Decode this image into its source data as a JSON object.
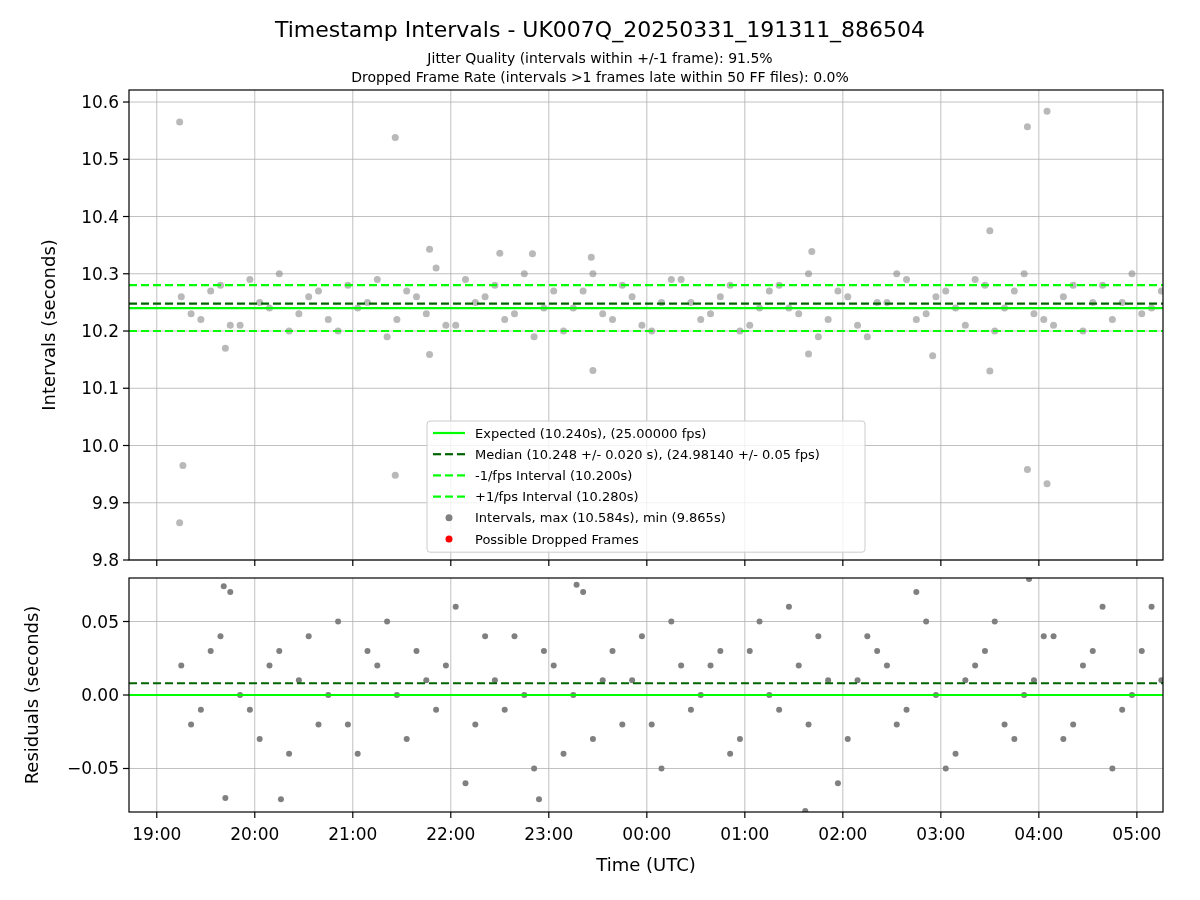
{
  "figure": {
    "title": "Timestamp Intervals - UK007Q_20250331_191311_886504",
    "subtitles": [
      "Jitter Quality (intervals within +/-1 frame): 91.5%",
      "Dropped Frame Rate (intervals >1 frames late within 50 FF files): 0.0%"
    ]
  },
  "panels": [
    {
      "chart_data": {
        "type": "scatter",
        "ylabel": "Intervals (seconds)",
        "grid": true,
        "xlim": [
          "2025-03-31T18:43",
          "2025-04-01T05:16"
        ],
        "ylim": [
          9.8,
          10.621
        ],
        "yticks": [
          {
            "value": 9.8,
            "label": "9.8"
          },
          {
            "value": 9.9,
            "label": "9.9"
          },
          {
            "value": 10.0,
            "label": "10.0"
          },
          {
            "value": 10.1,
            "label": "10.1"
          },
          {
            "value": 10.2,
            "label": "10.2"
          },
          {
            "value": 10.3,
            "label": "10.3"
          },
          {
            "value": 10.4,
            "label": "10.4"
          },
          {
            "value": 10.5,
            "label": "10.5"
          },
          {
            "value": 10.6,
            "label": "10.6"
          }
        ],
        "x": [
          "2025-03-31T19:15",
          "2025-03-31T19:27",
          "2025-03-31T19:39",
          "2025-03-31T19:51",
          "2025-03-31T20:03",
          "2025-03-31T20:15",
          "2025-03-31T20:27",
          "2025-03-31T20:39",
          "2025-03-31T20:51",
          "2025-03-31T21:03",
          "2025-03-31T21:15",
          "2025-03-31T21:27",
          "2025-03-31T21:39",
          "2025-03-31T21:51",
          "2025-03-31T22:03",
          "2025-03-31T22:15",
          "2025-03-31T22:27",
          "2025-03-31T22:39",
          "2025-03-31T22:51",
          "2025-03-31T23:03",
          "2025-03-31T23:15",
          "2025-03-31T23:27",
          "2025-03-31T23:39",
          "2025-03-31T23:51",
          "2025-04-01T00:03",
          "2025-04-01T00:15",
          "2025-04-01T00:27",
          "2025-04-01T00:39",
          "2025-04-01T00:51",
          "2025-04-01T01:03",
          "2025-04-01T01:15",
          "2025-04-01T01:27",
          "2025-04-01T01:39",
          "2025-04-01T01:51",
          "2025-04-01T02:03",
          "2025-04-01T02:15",
          "2025-04-01T02:27",
          "2025-04-01T02:39",
          "2025-04-01T02:51",
          "2025-04-01T03:03",
          "2025-04-01T03:15",
          "2025-04-01T03:27",
          "2025-04-01T03:39",
          "2025-04-01T03:51",
          "2025-04-01T04:03",
          "2025-04-01T04:15",
          "2025-04-01T04:27",
          "2025-04-01T04:39",
          "2025-04-01T04:51",
          "2025-04-01T05:03",
          "2025-04-01T05:15",
          "2025-03-31T19:21",
          "2025-03-31T19:33",
          "2025-03-31T19:45",
          "2025-03-31T19:57",
          "2025-03-31T20:09",
          "2025-03-31T20:21",
          "2025-03-31T20:33",
          "2025-03-31T20:45",
          "2025-03-31T20:57",
          "2025-03-31T21:09",
          "2025-03-31T21:21",
          "2025-03-31T21:33",
          "2025-03-31T21:45",
          "2025-03-31T21:57",
          "2025-03-31T22:09",
          "2025-03-31T22:21",
          "2025-03-31T22:33",
          "2025-03-31T22:45",
          "2025-03-31T22:57",
          "2025-03-31T23:09",
          "2025-03-31T23:21",
          "2025-03-31T23:33",
          "2025-03-31T23:45",
          "2025-03-31T23:57",
          "2025-04-01T00:09",
          "2025-04-01T00:21",
          "2025-04-01T00:33",
          "2025-04-01T00:45",
          "2025-04-01T00:57",
          "2025-04-01T01:09",
          "2025-04-01T01:21",
          "2025-04-01T01:33",
          "2025-04-01T01:45",
          "2025-04-01T01:57",
          "2025-04-01T02:09",
          "2025-04-01T02:21",
          "2025-04-01T02:33",
          "2025-04-01T02:45",
          "2025-04-01T02:57",
          "2025-04-01T03:09",
          "2025-04-01T03:21",
          "2025-04-01T03:33",
          "2025-04-01T03:45",
          "2025-04-01T03:57",
          "2025-04-01T04:09",
          "2025-04-01T04:21",
          "2025-04-01T04:33",
          "2025-04-01T04:45",
          "2025-04-01T04:57",
          "2025-04-01T05:09",
          "2025-03-31T19:14",
          "2025-03-31T19:14",
          "2025-03-31T19:16",
          "2025-03-31T21:26",
          "2025-03-31T21:26",
          "2025-03-31T23:26",
          "2025-03-31T23:27",
          "2025-03-31T21:47",
          "2025-03-31T21:47",
          "2025-03-31T22:30",
          "2025-03-31T22:50",
          "2025-04-01T01:41",
          "2025-04-01T01:39",
          "2025-04-01T02:55",
          "2025-04-01T03:30",
          "2025-04-01T03:30",
          "2025-04-01T03:53",
          "2025-04-01T04:05",
          "2025-04-01T03:53",
          "2025-04-01T04:05",
          "2025-03-31T19:42"
        ],
        "series": [
          {
            "color": "#808080",
            "values": [
              10.26,
              10.22,
              10.28,
              10.21,
              10.25,
              10.3,
              10.23,
              10.27,
              10.2,
              10.24,
              10.29,
              10.22,
              10.26,
              10.31,
              10.21,
              10.25,
              10.28,
              10.23,
              10.19,
              10.27,
              10.24,
              10.3,
              10.22,
              10.26,
              10.2,
              10.29,
              10.25,
              10.23,
              10.28,
              10.21,
              10.27,
              10.24,
              10.3,
              10.22,
              10.26,
              10.19,
              10.25,
              10.29,
              10.23,
              10.27,
              10.21,
              10.28,
              10.24,
              10.3,
              10.22,
              10.26,
              10.2,
              10.28,
              10.25,
              10.23,
              10.27,
              10.23,
              10.27,
              10.21,
              10.29,
              10.24,
              10.2,
              10.26,
              10.22,
              10.28,
              10.25,
              10.19,
              10.27,
              10.23,
              10.21,
              10.29,
              10.26,
              10.22,
              10.3,
              10.24,
              10.2,
              10.27,
              10.23,
              10.28,
              10.21,
              10.25,
              10.29,
              10.22,
              10.26,
              10.2,
              10.24,
              10.28,
              10.23,
              10.19,
              10.27,
              10.21,
              10.25,
              10.3,
              10.22,
              10.26,
              10.24,
              10.29,
              10.2,
              10.27,
              10.23,
              10.21,
              10.28,
              10.25,
              10.22,
              10.3,
              10.24,
              10.565,
              9.865,
              9.965,
              10.538,
              9.948,
              10.329,
              10.131,
              10.343,
              10.159,
              10.336,
              10.335,
              10.339,
              10.16,
              10.157,
              10.375,
              10.13,
              10.557,
              10.584,
              9.958,
              9.933,
              10.17
            ]
          }
        ],
        "ref_lines": [
          {
            "axis": "y",
            "value": 10.24,
            "color": "#00ff00"
          },
          {
            "axis": "y",
            "value": 10.248,
            "color": "#006400"
          },
          {
            "axis": "y",
            "value": 10.2,
            "color": "#00ff00"
          },
          {
            "axis": "y",
            "value": 10.28,
            "color": "#00ff00"
          }
        ]
      },
      "legend": [
        {
          "kind": "line",
          "color": "#00ff00",
          "label": "Expected (10.240s), (25.00000 fps)"
        },
        {
          "kind": "dashed",
          "color": "#006400",
          "label": "Median (10.248 +/- 0.020 s), (24.98140 +/- 0.05 fps)"
        },
        {
          "kind": "dashed",
          "color": "#00ff00",
          "label": "-1/fps Interval (10.200s)"
        },
        {
          "kind": "dashed",
          "color": "#00ff00",
          "label": "+1/fps Interval (10.280s)"
        },
        {
          "kind": "marker",
          "color": "#808080",
          "label": "Intervals, max (10.584s), min (9.865s)"
        },
        {
          "kind": "marker",
          "color": "#ff0000",
          "label": "Possible Dropped Frames"
        }
      ]
    },
    {
      "chart_data": {
        "type": "scatter",
        "xlabel": "Time (UTC)",
        "ylabel": "Residuals (seconds)",
        "grid": true,
        "xlim": [
          "2025-03-31T18:43",
          "2025-04-01T05:16"
        ],
        "ylim": [
          -0.0796,
          0.0796
        ],
        "xticks": [
          {
            "value": "2025-03-31T19:00",
            "label": "19:00"
          },
          {
            "value": "2025-03-31T20:00",
            "label": "20:00"
          },
          {
            "value": "2025-03-31T21:00",
            "label": "21:00"
          },
          {
            "value": "2025-03-31T22:00",
            "label": "22:00"
          },
          {
            "value": "2025-03-31T23:00",
            "label": "23:00"
          },
          {
            "value": "2025-04-01T00:00",
            "label": "00:00"
          },
          {
            "value": "2025-04-01T01:00",
            "label": "01:00"
          },
          {
            "value": "2025-04-01T02:00",
            "label": "02:00"
          },
          {
            "value": "2025-04-01T03:00",
            "label": "03:00"
          },
          {
            "value": "2025-04-01T04:00",
            "label": "04:00"
          },
          {
            "value": "2025-04-01T05:00",
            "label": "05:00"
          }
        ],
        "yticks": [
          {
            "value": -0.05,
            "label": "−0.05"
          },
          {
            "value": 0,
            "label": "0.00"
          },
          {
            "value": 0.05,
            "label": "0.05"
          }
        ],
        "x": [
          "2025-03-31T19:15",
          "2025-03-31T19:27",
          "2025-03-31T19:39",
          "2025-03-31T19:51",
          "2025-03-31T20:03",
          "2025-03-31T20:15",
          "2025-03-31T20:27",
          "2025-03-31T20:39",
          "2025-03-31T20:51",
          "2025-03-31T21:03",
          "2025-03-31T21:15",
          "2025-03-31T21:27",
          "2025-03-31T21:39",
          "2025-03-31T21:51",
          "2025-03-31T22:03",
          "2025-03-31T22:15",
          "2025-03-31T22:27",
          "2025-03-31T22:39",
          "2025-03-31T22:51",
          "2025-03-31T23:03",
          "2025-03-31T23:15",
          "2025-03-31T23:27",
          "2025-03-31T23:39",
          "2025-03-31T23:51",
          "2025-04-01T00:03",
          "2025-04-01T00:15",
          "2025-04-01T00:27",
          "2025-04-01T00:39",
          "2025-04-01T00:51",
          "2025-04-01T01:03",
          "2025-04-01T01:15",
          "2025-04-01T01:27",
          "2025-04-01T01:39",
          "2025-04-01T01:51",
          "2025-04-01T02:03",
          "2025-04-01T02:15",
          "2025-04-01T02:27",
          "2025-04-01T02:39",
          "2025-04-01T02:51",
          "2025-04-01T03:03",
          "2025-04-01T03:15",
          "2025-04-01T03:27",
          "2025-04-01T03:39",
          "2025-04-01T03:51",
          "2025-04-01T04:03",
          "2025-04-01T04:15",
          "2025-04-01T04:27",
          "2025-04-01T04:39",
          "2025-04-01T04:51",
          "2025-04-01T05:03",
          "2025-04-01T05:15",
          "2025-03-31T19:21",
          "2025-03-31T19:33",
          "2025-03-31T19:45",
          "2025-03-31T19:57",
          "2025-03-31T20:09",
          "2025-03-31T20:21",
          "2025-03-31T20:33",
          "2025-03-31T20:45",
          "2025-03-31T20:57",
          "2025-03-31T21:09",
          "2025-03-31T21:21",
          "2025-03-31T21:33",
          "2025-03-31T21:45",
          "2025-03-31T21:57",
          "2025-03-31T22:09",
          "2025-03-31T22:21",
          "2025-03-31T22:33",
          "2025-03-31T22:45",
          "2025-03-31T22:57",
          "2025-03-31T23:09",
          "2025-03-31T23:21",
          "2025-03-31T23:33",
          "2025-03-31T23:45",
          "2025-03-31T23:57",
          "2025-04-01T00:09",
          "2025-04-01T00:21",
          "2025-04-01T00:33",
          "2025-04-01T00:45",
          "2025-04-01T00:57",
          "2025-04-01T01:09",
          "2025-04-01T01:21",
          "2025-04-01T01:33",
          "2025-04-01T01:45",
          "2025-04-01T01:57",
          "2025-04-01T02:09",
          "2025-04-01T02:21",
          "2025-04-01T02:33",
          "2025-04-01T02:45",
          "2025-04-01T02:57",
          "2025-04-01T03:09",
          "2025-04-01T03:21",
          "2025-04-01T03:33",
          "2025-04-01T03:45",
          "2025-04-01T03:57",
          "2025-04-01T04:09",
          "2025-04-01T04:21",
          "2025-04-01T04:33",
          "2025-04-01T04:45",
          "2025-04-01T04:57",
          "2025-04-01T05:09",
          "2025-03-31T19:41",
          "2025-03-31T19:42",
          "2025-03-31T20:16",
          "2025-03-31T23:17",
          "2025-03-31T22:54",
          "2025-04-01T01:37",
          "2025-04-01T03:54"
        ],
        "series": [
          {
            "color": "#808080",
            "values": [
              0.02,
              -0.01,
              0.04,
              0.0,
              -0.03,
              0.03,
              0.01,
              -0.02,
              0.05,
              -0.04,
              0.02,
              0.0,
              0.03,
              -0.01,
              0.06,
              -0.02,
              0.01,
              0.04,
              -0.05,
              0.02,
              0.0,
              -0.03,
              0.03,
              0.01,
              -0.02,
              0.05,
              -0.01,
              0.02,
              -0.04,
              0.03,
              0.0,
              0.06,
              -0.02,
              0.01,
              -0.03,
              0.04,
              0.02,
              -0.01,
              0.05,
              -0.05,
              0.01,
              0.03,
              -0.02,
              0.0,
              0.04,
              -0.03,
              0.02,
              0.06,
              -0.01,
              0.03,
              0.01,
              -0.02,
              0.03,
              0.07,
              -0.01,
              0.02,
              -0.04,
              0.04,
              0.0,
              -0.02,
              0.03,
              0.05,
              -0.03,
              0.01,
              0.02,
              -0.06,
              0.04,
              -0.01,
              0.0,
              0.03,
              -0.04,
              0.07,
              0.01,
              -0.02,
              0.04,
              -0.05,
              0.02,
              0.0,
              0.03,
              -0.03,
              0.05,
              -0.01,
              0.02,
              0.04,
              -0.06,
              0.01,
              0.03,
              -0.02,
              0.07,
              0.0,
              -0.04,
              0.02,
              0.05,
              -0.03,
              0.01,
              0.04,
              -0.02,
              0.03,
              -0.05,
              0.0,
              0.06,
              0.074,
              -0.07,
              -0.071,
              0.075,
              -0.071,
              -0.079,
              0.079
            ]
          }
        ],
        "ref_lines": [
          {
            "axis": "y",
            "value": 0,
            "color": "#00ff00"
          },
          {
            "axis": "y",
            "value": 0.008,
            "color": "#006400"
          }
        ]
      }
    }
  ]
}
